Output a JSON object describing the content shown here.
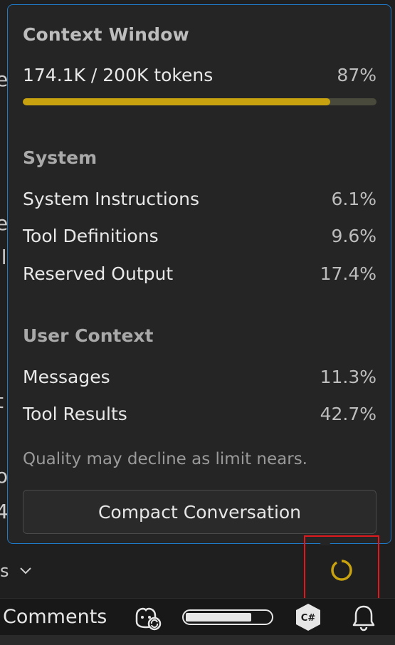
{
  "popup": {
    "title": "Context Window",
    "usage": {
      "label": "174.1K / 200K tokens",
      "percent_label": "87%",
      "fraction": 0.87
    },
    "sections": [
      {
        "heading": "System",
        "items": [
          {
            "label": "System Instructions",
            "value": "6.1%"
          },
          {
            "label": "Tool Definitions",
            "value": "9.6%"
          },
          {
            "label": "Reserved Output",
            "value": "17.4%"
          }
        ]
      },
      {
        "heading": "User Context",
        "items": [
          {
            "label": "Messages",
            "value": "11.3%"
          },
          {
            "label": "Tool Results",
            "value": "42.7%"
          }
        ]
      }
    ],
    "hint": "Quality may decline as limit nears.",
    "compact_button_label": "Compact Conversation"
  },
  "toolbar": {
    "dropdown_fragment": "s"
  },
  "statusbar": {
    "comments_label": "Comments",
    "language_badge": "C#"
  },
  "colors": {
    "accent_border": "#1f7ac8",
    "progress_fill": "#c9a20f",
    "highlight_box": "#e0191e"
  },
  "icons": [
    "chevron-down-icon",
    "context-ring-icon",
    "copilot-icon",
    "csharp-icon",
    "bell-icon"
  ]
}
